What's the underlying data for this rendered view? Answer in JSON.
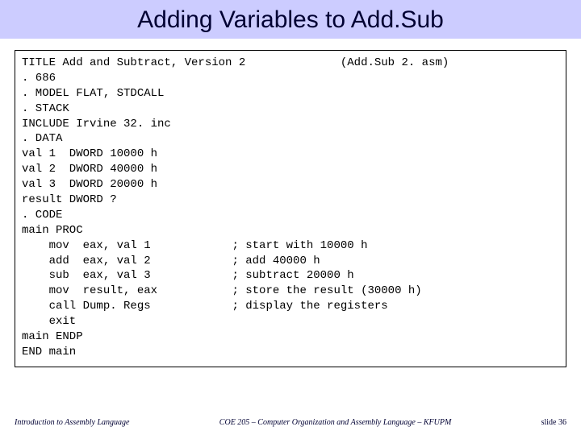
{
  "title": "Adding Variables to Add.Sub",
  "code": "TITLE Add and Subtract, Version 2              (Add.Sub 2. asm)\n. 686\n. MODEL FLAT, STDCALL\n. STACK\nINCLUDE Irvine 32. inc\n. DATA\nval 1  DWORD 10000 h\nval 2  DWORD 40000 h\nval 3  DWORD 20000 h\nresult DWORD ?\n. CODE\nmain PROC\n    mov  eax, val 1            ; start with 10000 h\n    add  eax, val 2            ; add 40000 h\n    sub  eax, val 3            ; subtract 20000 h\n    mov  result, eax           ; store the result (30000 h)\n    call Dump. Regs            ; display the registers\n    exit\nmain ENDP\nEND main",
  "footer": {
    "left": "Introduction to Assembly Language",
    "center": "COE 205 – Computer Organization and Assembly Language – KFUPM",
    "right": "slide 36"
  }
}
